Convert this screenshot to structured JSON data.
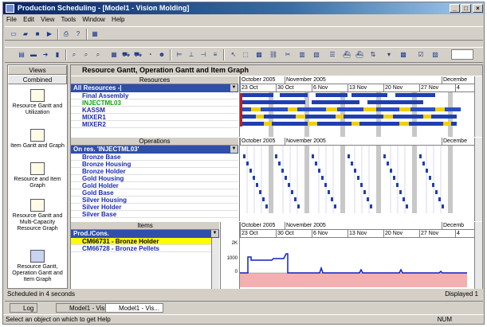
{
  "window": {
    "title": "Production Scheduling - [Model1 - Vision Molding]"
  },
  "menu": [
    "File",
    "Edit",
    "View",
    "Tools",
    "Window",
    "Help"
  ],
  "views": {
    "header": "Views",
    "tab": "Combined",
    "items": [
      "Resource Gantt and Utilization",
      "Item Gantt and Graph",
      "Resource and Item Graph",
      "Resource Gantt and Multi-Capacity Resource Graph",
      "Resource Gantt, Operation Gantt and Item Graph"
    ]
  },
  "main": {
    "title": "Resource Gantt, Operation Gantt and Item Graph"
  },
  "resources": {
    "header": "Resources",
    "combo": "All Resources -|",
    "rows": [
      "Final Assembly",
      "INJECTML03",
      "KASSM",
      "MIXER1",
      "MIXER2"
    ]
  },
  "operations": {
    "header": "Operations",
    "combo": "On res. 'INJECTML03'",
    "rows": [
      "Bronze Base",
      "Bronze Housing",
      "Bronze Holder",
      "Gold Housing",
      "Gold Holder",
      "Gold Base",
      "Silver Housing",
      "Silver Holder",
      "Silver Base"
    ]
  },
  "items": {
    "header": "Items",
    "combo": "Prod./Cons.",
    "rows": [
      "CM66731 - Bronze Holder",
      "CM66728 - Bronze Pellets"
    ]
  },
  "calendar": {
    "months": [
      "October 2005",
      "November 2005",
      "Decembe"
    ],
    "days": [
      "23 Oct",
      "30 Oct",
      "6 Nov",
      "13 Nov",
      "20 Nov",
      "27 Nov",
      "4"
    ],
    "items_months": [
      "October 2005",
      "November 2005",
      "Decemb"
    ]
  },
  "graph": {
    "yticks": [
      "2K",
      "1000",
      "0"
    ]
  },
  "status": {
    "message": "Scheduled in 4 seconds",
    "displayed": "Displayed 1",
    "help": "Select an object on which to get Help",
    "num": "NUM"
  },
  "tabs": [
    "Log",
    "Model1 - Visi...",
    "Model1 - Vis..."
  ],
  "colors": {
    "titlebar": "#0a246a",
    "selected_row": "#fffb00",
    "combo": "#2f4fa8",
    "gantt_bar": "#1f3fb0",
    "gantt_yellow": "#f0d000",
    "graph_line": "#1020c0",
    "graph_fill": "#f4b0b0"
  }
}
